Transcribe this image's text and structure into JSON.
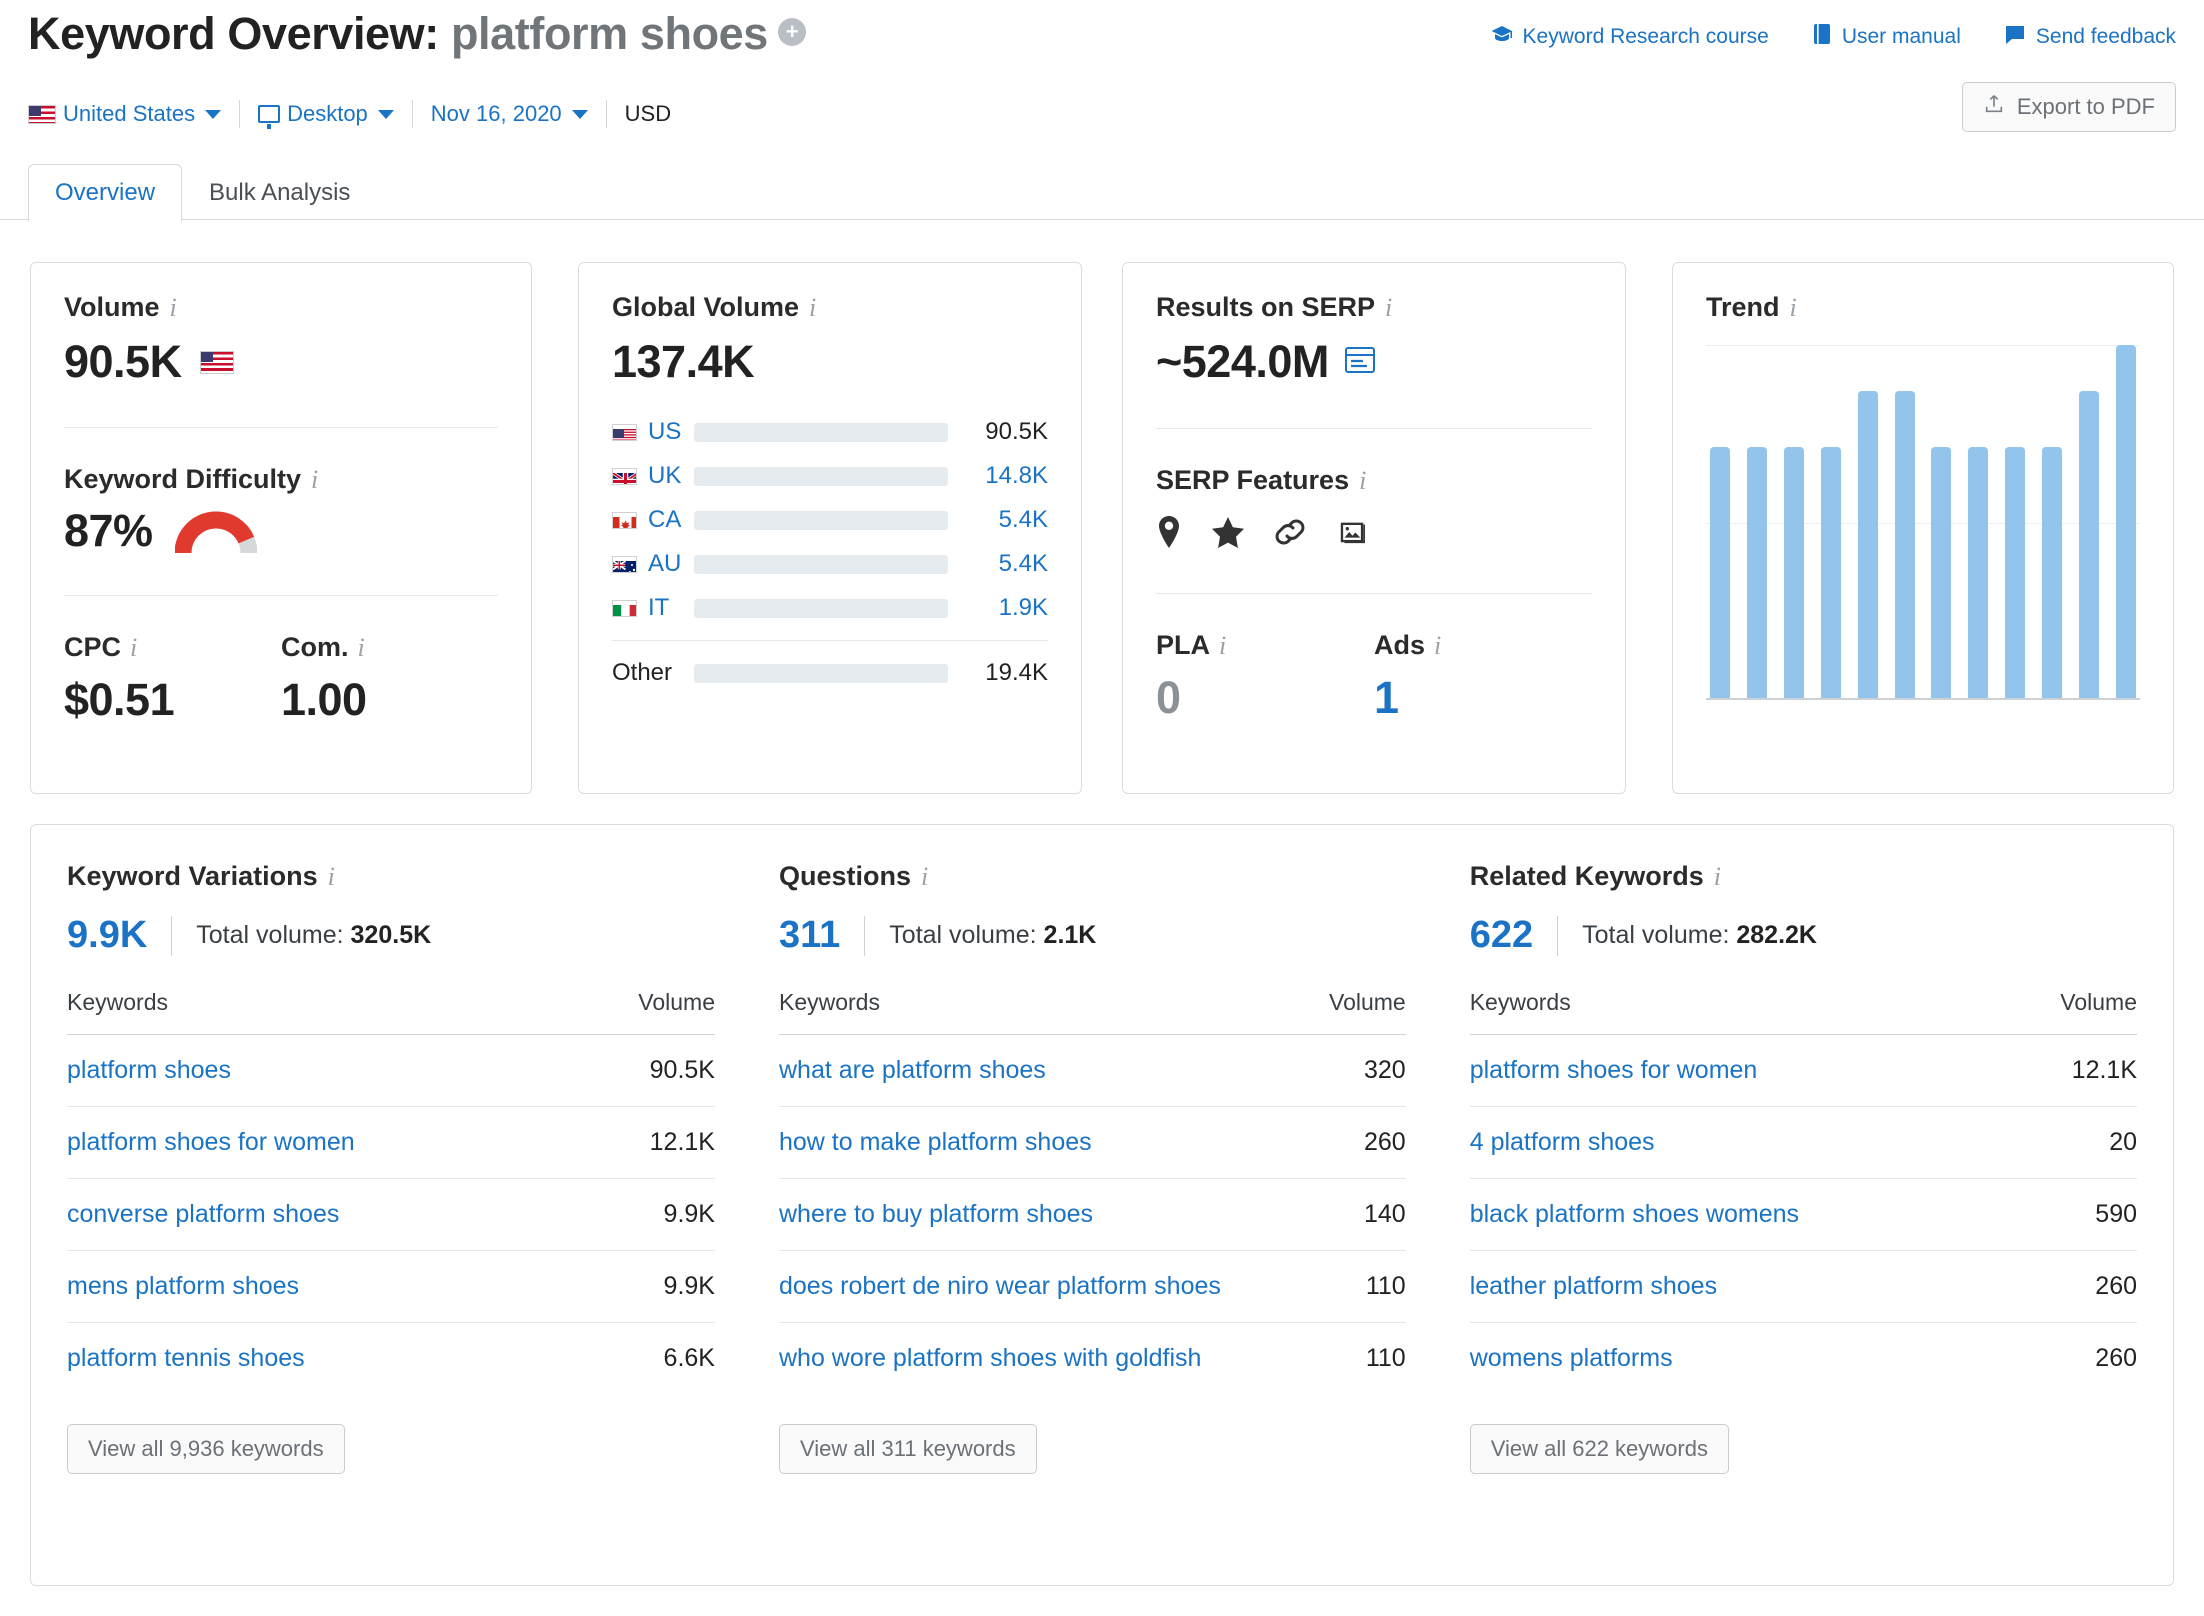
{
  "header": {
    "title_prefix": "Keyword Overview:",
    "keyword": "platform shoes",
    "add_icon": "+",
    "database": "United States",
    "device": "Desktop",
    "date": "Nov 16, 2020",
    "currency": "USD",
    "links": [
      {
        "label": "Keyword Research course",
        "icon": "graduation-cap-icon"
      },
      {
        "label": "User manual",
        "icon": "book-icon"
      },
      {
        "label": "Send feedback",
        "icon": "speech-bubble-icon"
      }
    ],
    "export_label": "Export to PDF"
  },
  "tabs": [
    {
      "label": "Overview",
      "active": true
    },
    {
      "label": "Bulk Analysis",
      "active": false
    }
  ],
  "volume_card": {
    "title": "Volume",
    "value": "90.5K",
    "flag": "us-flag-icon",
    "kd_title": "Keyword Difficulty",
    "kd_value": "87%",
    "kd_percent": 87,
    "kd_color": "#e03a2f",
    "cpc_label": "CPC",
    "cpc_value": "$0.51",
    "com_label": "Com.",
    "com_value": "1.00"
  },
  "global_volume_card": {
    "title": "Global Volume",
    "value": "137.4K",
    "rows": [
      {
        "cc": "US",
        "value": "90.5K",
        "pct": 66,
        "color": "#3a7bc8",
        "flag": "us",
        "link": false
      },
      {
        "cc": "UK",
        "value": "14.8K",
        "pct": 11,
        "color": "#79b6ee",
        "flag": "uk",
        "link": true
      },
      {
        "cc": "CA",
        "value": "5.4K",
        "pct": 4,
        "color": "#79b6ee",
        "flag": "ca",
        "link": true
      },
      {
        "cc": "AU",
        "value": "5.4K",
        "pct": 4,
        "color": "#79b6ee",
        "flag": "au",
        "link": true
      },
      {
        "cc": "IT",
        "value": "1.9K",
        "pct": 2.6,
        "color": "#79b6ee",
        "flag": "it",
        "link": true
      }
    ],
    "other": {
      "cc": "Other",
      "value": "19.4K",
      "pct": 14,
      "color": "#79b6ee"
    }
  },
  "serp_card": {
    "title": "Results on SERP",
    "value": "~524.0M",
    "results_icon": "serp-preview-icon",
    "features_title": "SERP Features",
    "features": [
      "map-pin-icon",
      "star-icon",
      "link-icon",
      "image-pack-icon"
    ],
    "pla_label": "PLA",
    "pla_value": "0",
    "ads_label": "Ads",
    "ads_value": "1"
  },
  "trend_card": {
    "title": "Trend"
  },
  "chart_data": {
    "type": "bar",
    "title": "Trend",
    "xlabel": "",
    "ylabel": "",
    "categories": [
      "1",
      "2",
      "3",
      "4",
      "5",
      "6",
      "7",
      "8",
      "9",
      "10",
      "11",
      "12"
    ],
    "values": [
      71,
      71,
      71,
      71,
      87,
      87,
      71,
      71,
      71,
      71,
      87,
      100
    ],
    "ylim": [
      0,
      100
    ],
    "grid": true,
    "gridlines": [
      50,
      100
    ],
    "legend": "none",
    "bar_color": "#93c5ec"
  },
  "keyword_variations": {
    "title": "Keyword Variations",
    "count": "9.9K",
    "total_volume_label": "Total volume:",
    "total_volume": "320.5K",
    "columns": [
      "Keywords",
      "Volume"
    ],
    "rows": [
      {
        "keyword": "platform shoes",
        "volume": "90.5K"
      },
      {
        "keyword": "platform shoes for women",
        "volume": "12.1K"
      },
      {
        "keyword": "converse platform shoes",
        "volume": "9.9K"
      },
      {
        "keyword": "mens platform shoes",
        "volume": "9.9K"
      },
      {
        "keyword": "platform tennis shoes",
        "volume": "6.6K"
      }
    ],
    "view_all": "View all 9,936 keywords"
  },
  "questions": {
    "title": "Questions",
    "count": "311",
    "total_volume_label": "Total volume:",
    "total_volume": "2.1K",
    "columns": [
      "Keywords",
      "Volume"
    ],
    "rows": [
      {
        "keyword": "what are platform shoes",
        "volume": "320"
      },
      {
        "keyword": "how to make platform shoes",
        "volume": "260"
      },
      {
        "keyword": "where to buy platform shoes",
        "volume": "140"
      },
      {
        "keyword": "does robert de niro wear platform shoes",
        "volume": "110"
      },
      {
        "keyword": "who wore platform shoes with goldfish",
        "volume": "110"
      }
    ],
    "view_all": "View all 311 keywords"
  },
  "related_keywords": {
    "title": "Related Keywords",
    "count": "622",
    "total_volume_label": "Total volume:",
    "total_volume": "282.2K",
    "columns": [
      "Keywords",
      "Volume"
    ],
    "rows": [
      {
        "keyword": "platform shoes for women",
        "volume": "12.1K"
      },
      {
        "keyword": "4 platform shoes",
        "volume": "20"
      },
      {
        "keyword": "black platform shoes womens",
        "volume": "590"
      },
      {
        "keyword": "leather platform shoes",
        "volume": "260"
      },
      {
        "keyword": "womens platforms",
        "volume": "260"
      }
    ],
    "view_all": "View all 622 keywords"
  },
  "colors": {
    "link": "#1a73c4",
    "accent_bar": "#93c5ec",
    "difficulty": "#e03a2f"
  }
}
